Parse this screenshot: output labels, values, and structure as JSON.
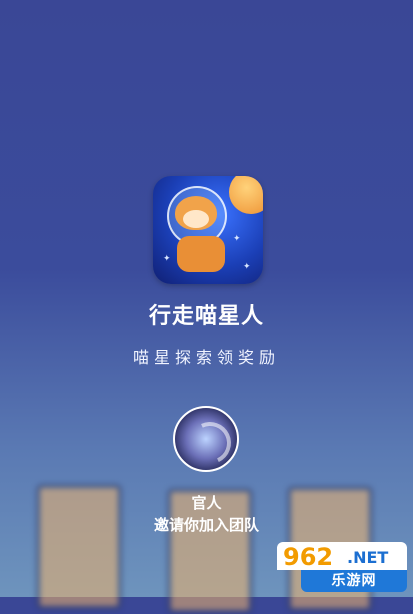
{
  "app": {
    "name": "行走喵星人",
    "slogan": "喵星探索领奖励"
  },
  "team": {
    "owner_label": "官人",
    "invite_text": "邀请你加入团队"
  },
  "watermark": {
    "number": "962",
    "suffix": ".NET",
    "site": "乐游网"
  },
  "colors": {
    "background_top": "#3a4796",
    "background_bottom": "#6e94bd",
    "watermark_orange": "#f29b00",
    "watermark_blue": "#1f78d8"
  }
}
